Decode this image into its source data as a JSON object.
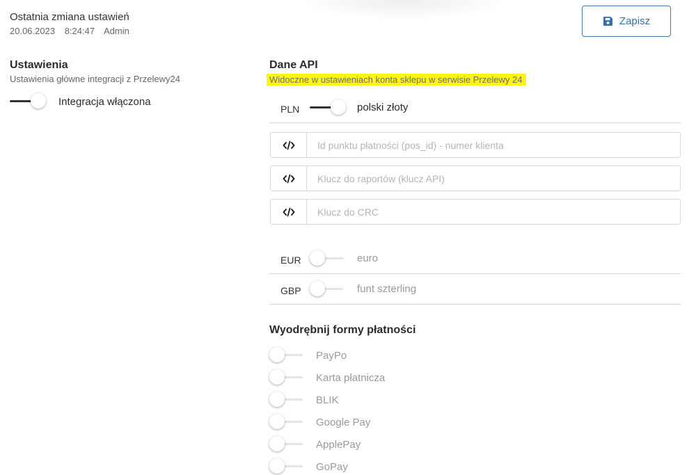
{
  "header": {
    "last_change_title": "Ostatnia zmiana ustawień",
    "date": "20.06.2023",
    "time": "8:24:47",
    "user": "Admin",
    "save_label": "Zapisz",
    "save_icon": "floppy-disk-icon",
    "accent_color": "#3470a9"
  },
  "settings": {
    "title": "Ustawienia",
    "description": "Ustawienia główne integracji z Przelewy24",
    "integration_label": "Integracja włączona",
    "integration_enabled": true
  },
  "api": {
    "title": "Dane API",
    "note": "Widoczne w ustawieniach konta sklepu w serwisie Przelewy 24",
    "note_highlight_color": "#fdf511",
    "currencies": [
      {
        "code": "PLN",
        "name": "polski złoty",
        "enabled": true,
        "fields": [
          {
            "icon": "code-icon",
            "placeholder": "Id punktu płatności (pos_id) - numer klienta",
            "value": ""
          },
          {
            "icon": "code-icon",
            "placeholder": "Klucz do raportów (klucz API)",
            "value": ""
          },
          {
            "icon": "code-icon",
            "placeholder": "Klucz do CRC",
            "value": ""
          }
        ]
      },
      {
        "code": "EUR",
        "name": "euro",
        "enabled": false
      },
      {
        "code": "GBP",
        "name": "funt szterling",
        "enabled": false
      }
    ]
  },
  "payment_methods": {
    "title": "Wyodrębnij formy płatności",
    "items": [
      {
        "label": "PayPo",
        "enabled": false
      },
      {
        "label": "Karta płatnicza",
        "enabled": false
      },
      {
        "label": "BLIK",
        "enabled": false
      },
      {
        "label": "Google Pay",
        "enabled": false
      },
      {
        "label": "ApplePay",
        "enabled": false
      },
      {
        "label": "GoPay",
        "enabled": false
      }
    ]
  }
}
